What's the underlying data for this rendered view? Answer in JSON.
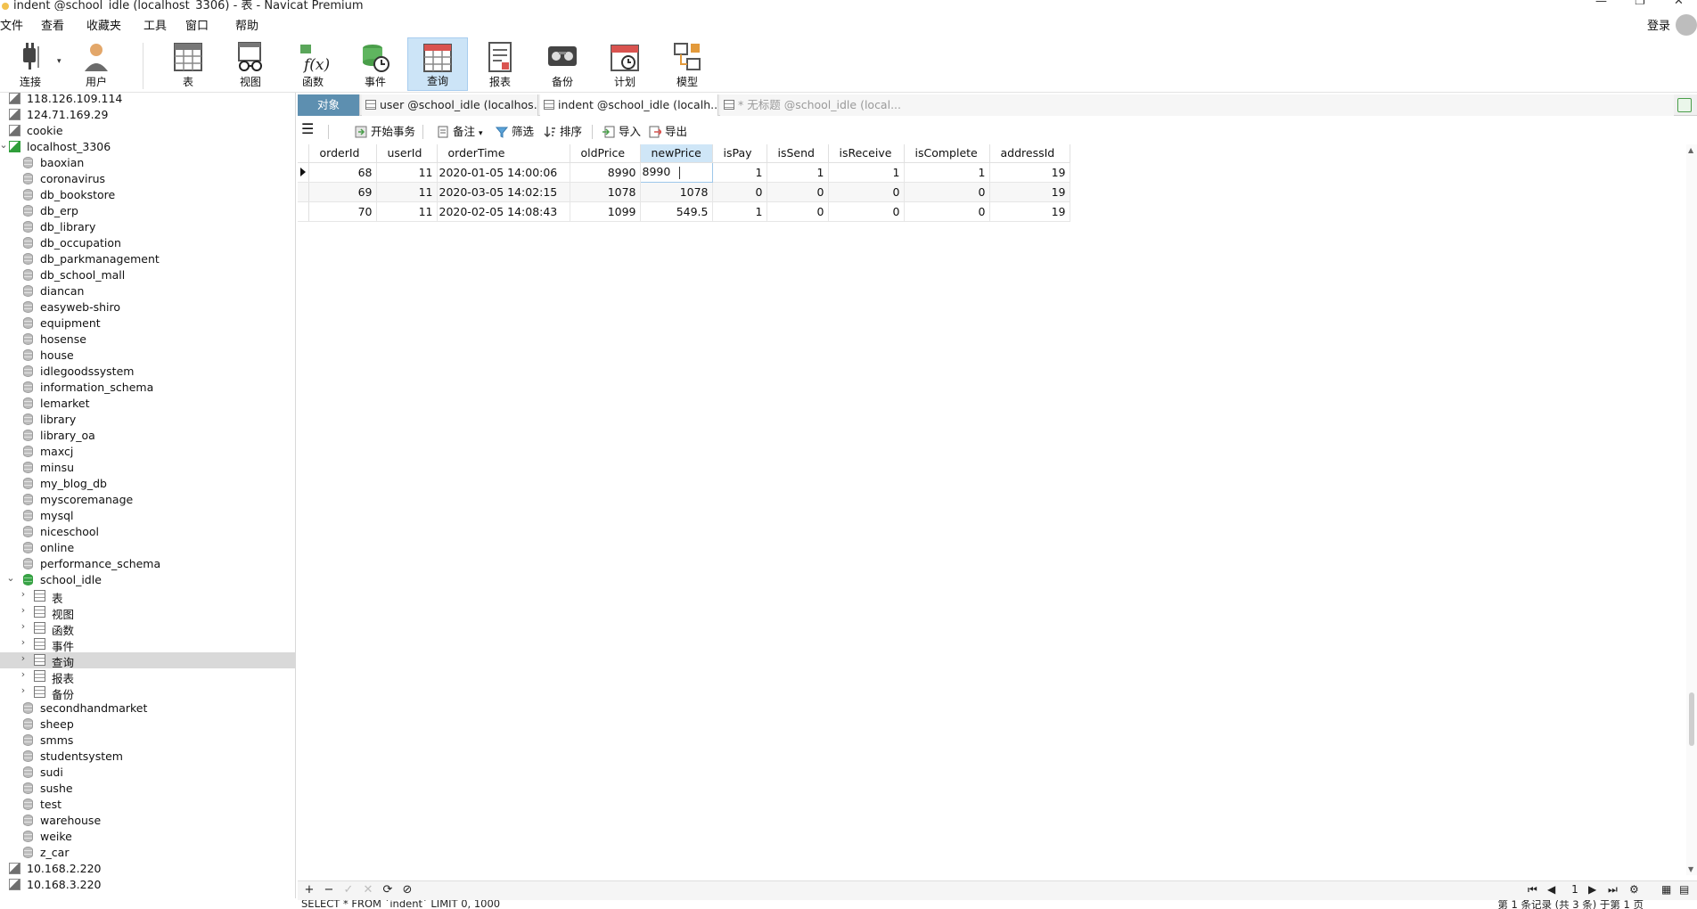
{
  "window": {
    "title": "indent @school_idle (localhost_3306) - 表 - Navicat Premium"
  },
  "menu": {
    "items": [
      "文件",
      "查看",
      "收藏夹",
      "工具",
      "窗口",
      "帮助"
    ],
    "login": "登录"
  },
  "ribbon": {
    "connect": "连接",
    "user": "用户",
    "table": "表",
    "view": "视图",
    "function": "函数",
    "event": "事件",
    "query": "查询",
    "report": "报表",
    "backup": "备份",
    "schedule": "计划",
    "model": "模型"
  },
  "sidebar": {
    "items": [
      {
        "label": "118.126.109.114",
        "type": "connection"
      },
      {
        "label": "124.71.169.29",
        "type": "connection"
      },
      {
        "label": "cookie",
        "type": "connection"
      },
      {
        "label": "localhost_3306",
        "type": "connection-open"
      },
      {
        "label": "baoxian",
        "type": "db"
      },
      {
        "label": "coronavirus",
        "type": "db"
      },
      {
        "label": "db_bookstore",
        "type": "db"
      },
      {
        "label": "db_erp",
        "type": "db"
      },
      {
        "label": "db_library",
        "type": "db"
      },
      {
        "label": "db_occupation",
        "type": "db"
      },
      {
        "label": "db_parkmanagement",
        "type": "db"
      },
      {
        "label": "db_school_mall",
        "type": "db"
      },
      {
        "label": "diancan",
        "type": "db"
      },
      {
        "label": "easyweb-shiro",
        "type": "db"
      },
      {
        "label": "equipment",
        "type": "db"
      },
      {
        "label": "hosense",
        "type": "db"
      },
      {
        "label": "house",
        "type": "db"
      },
      {
        "label": "idlegoodssystem",
        "type": "db"
      },
      {
        "label": "information_schema",
        "type": "db"
      },
      {
        "label": "lemarket",
        "type": "db"
      },
      {
        "label": "library",
        "type": "db"
      },
      {
        "label": "library_oa",
        "type": "db"
      },
      {
        "label": "maxcj",
        "type": "db"
      },
      {
        "label": "minsu",
        "type": "db"
      },
      {
        "label": "my_blog_db",
        "type": "db"
      },
      {
        "label": "myscoremanage",
        "type": "db"
      },
      {
        "label": "mysql",
        "type": "db"
      },
      {
        "label": "niceschool",
        "type": "db"
      },
      {
        "label": "online",
        "type": "db"
      },
      {
        "label": "performance_schema",
        "type": "db"
      },
      {
        "label": "school_idle",
        "type": "db-open"
      },
      {
        "label": "表",
        "type": "child"
      },
      {
        "label": "视图",
        "type": "child"
      },
      {
        "label": "函数",
        "type": "child"
      },
      {
        "label": "事件",
        "type": "child"
      },
      {
        "label": "查询",
        "type": "child-selected"
      },
      {
        "label": "报表",
        "type": "child"
      },
      {
        "label": "备份",
        "type": "child"
      },
      {
        "label": "secondhandmarket",
        "type": "db"
      },
      {
        "label": "sheep",
        "type": "db"
      },
      {
        "label": "smms",
        "type": "db"
      },
      {
        "label": "studentsystem",
        "type": "db"
      },
      {
        "label": "sudi",
        "type": "db"
      },
      {
        "label": "sushe",
        "type": "db"
      },
      {
        "label": "test",
        "type": "db"
      },
      {
        "label": "warehouse",
        "type": "db"
      },
      {
        "label": "weike",
        "type": "db"
      },
      {
        "label": "z_car",
        "type": "db"
      },
      {
        "label": "10.168.2.220",
        "type": "connection"
      },
      {
        "label": "10.168.3.220",
        "type": "connection"
      }
    ]
  },
  "tabs": {
    "objects": "对象",
    "t1": "user @school_idle (localhos...",
    "t2": "indent @school_idle (localh...",
    "t3": "* 无标题 @school_idle (local..."
  },
  "toolbar": {
    "begin_tx": "开始事务",
    "note": "备注",
    "filter": "筛选",
    "sort": "排序",
    "import": "导入",
    "export": "导出"
  },
  "grid": {
    "columns": [
      "orderId",
      "userId",
      "orderTime",
      "oldPrice",
      "newPrice",
      "isPay",
      "isSend",
      "isReceive",
      "isComplete",
      "addressId"
    ],
    "rows": [
      [
        "68",
        "11",
        "2020-01-05 14:00:06",
        "8990",
        "8990",
        "1",
        "1",
        "1",
        "1",
        "19"
      ],
      [
        "69",
        "11",
        "2020-03-05 14:02:15",
        "1078",
        "1078",
        "0",
        "0",
        "0",
        "0",
        "19"
      ],
      [
        "70",
        "11",
        "2020-02-05 14:08:43",
        "1099",
        "549.5",
        "1",
        "0",
        "0",
        "0",
        "19"
      ]
    ]
  },
  "pager": {
    "page": "1"
  },
  "status": {
    "sql": "SELECT * FROM `indent` LIMIT 0, 1000",
    "records": "第 1 条记录 (共 3 条) 于第 1 页"
  }
}
